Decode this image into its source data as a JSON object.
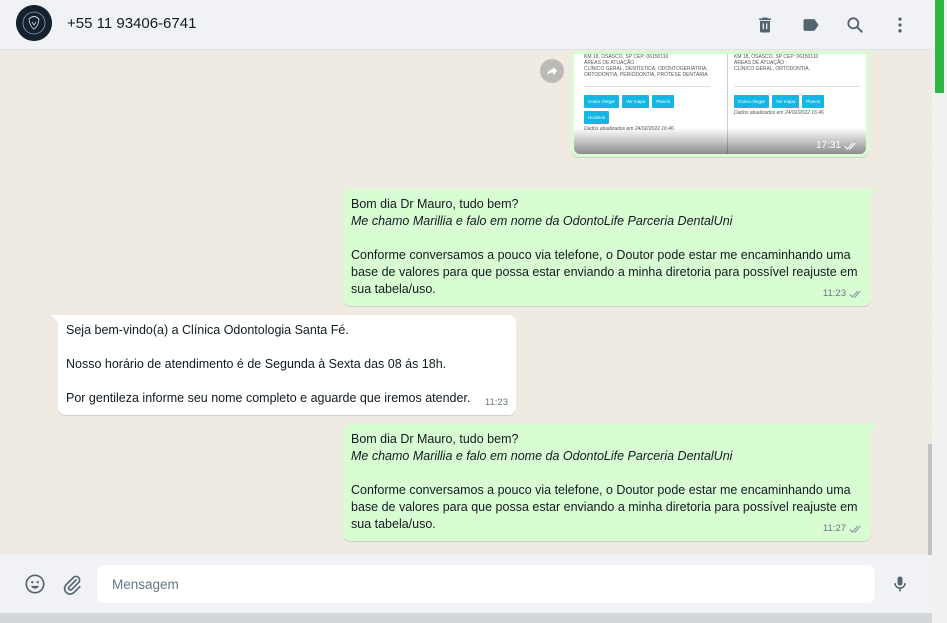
{
  "header": {
    "contact_name": "+55 11 93406-6741",
    "icons": [
      "delete-icon",
      "label-icon",
      "search-icon",
      "menu-icon"
    ]
  },
  "image_message": {
    "col1": {
      "lines": [
        "KM 18, OSASCO, SP CEP: 06150110",
        "ÁREAS DE ATUAÇÃO :",
        "CLÍNICO GERAL, DENTÍSTICA, ODONTOGERIATRIA,",
        "ORTODONTIA, PERIODONTIA, PRÓTESE DENTÁRIA"
      ],
      "buttons": [
        "Como chegar",
        "Ver mapa",
        "Planos",
        "Horários"
      ],
      "updated": "Dados atualizados em 24/02/2022 16:46"
    },
    "col2": {
      "lines": [
        "KM 18, OSASCO, SP CEP: 06150110",
        "ÁREAS DE ATUAÇÃO :",
        "CLÍNICO GERAL, ORTODONTIA."
      ],
      "buttons": [
        "Como chegar",
        "Ver mapa",
        "Planos"
      ],
      "updated": "Dados atualizados em 24/02/2022 16:46"
    },
    "time": "17:31"
  },
  "messages": [
    {
      "greeting": "Bom dia Dr Mauro, tudo bem?",
      "intro": "Me chamo Marillia e falo em nome da OdontoLife Parceria DentalUni",
      "body": "Conforme conversamos a pouco via telefone, o Doutor pode estar me encaminhando uma base de valores para que possa estar enviando a minha diretoria para possível reajuste em sua tabela/uso.",
      "time": "11:23"
    },
    {
      "line1": "Seja bem-vindo(a) a Clínica Odontologia Santa Fé.",
      "line2": "Nosso horário de atendimento é de Segunda à Sexta das 08 ás 18h.",
      "line3": "Por gentileza informe seu nome completo e aguarde que iremos atender.",
      "time": "11:23"
    },
    {
      "greeting": "Bom dia Dr Mauro, tudo bem?",
      "intro": "Me chamo Marillia e falo em nome da OdontoLife Parceria DentalUni",
      "body": "Conforme conversamos a pouco via telefone, o Doutor pode estar me encaminhando uma base de valores para que possa estar enviando a minha diretoria para possível reajuste em sua tabela/uso.",
      "time": "11:27"
    }
  ],
  "footer": {
    "placeholder": "Mensagem",
    "icons": [
      "emoji-icon",
      "attach-icon",
      "mic-icon"
    ]
  },
  "colors": {
    "outgoing_bubble": "#d9fdd3",
    "incoming_bubble": "#ffffff",
    "chat_background": "#efeae2",
    "accent": "#2db742"
  }
}
